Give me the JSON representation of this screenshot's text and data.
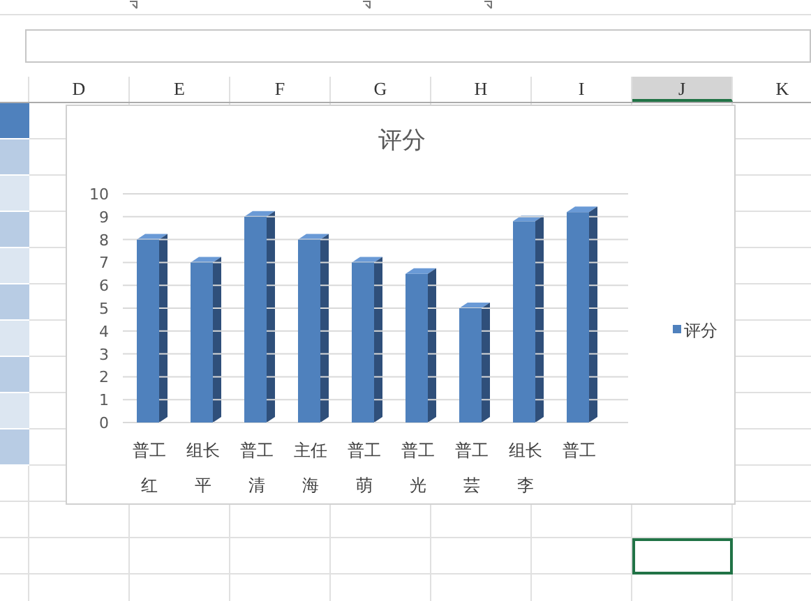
{
  "columns": [
    {
      "label": "D",
      "selected": false
    },
    {
      "label": "E",
      "selected": false
    },
    {
      "label": "F",
      "selected": false
    },
    {
      "label": "G",
      "selected": false
    },
    {
      "label": "H",
      "selected": false
    },
    {
      "label": "I",
      "selected": false
    },
    {
      "label": "J",
      "selected": true
    },
    {
      "label": "K",
      "selected": false
    }
  ],
  "shaded_cells": [
    {
      "color": "#4f81bd"
    },
    {
      "color": "#b8cce4"
    },
    {
      "color": "#dce6f1"
    },
    {
      "color": "#b8cce4"
    },
    {
      "color": "#dce6f1"
    },
    {
      "color": "#b8cce4"
    },
    {
      "color": "#dce6f1"
    },
    {
      "color": "#b8cce4"
    },
    {
      "color": "#dce6f1"
    },
    {
      "color": "#b8cce4"
    }
  ],
  "chart": {
    "chart_data": {
      "type": "bar",
      "title": "评分",
      "categories": [
        "普工红",
        "组长平",
        "普工清",
        "主任海",
        "普工萌",
        "普工光",
        "普工芸",
        "组长李",
        "普工"
      ],
      "series": [
        {
          "name": "评分",
          "color": "#4f81bd",
          "values": [
            8,
            7,
            9,
            8,
            7,
            6.5,
            5,
            8.8,
            9.2
          ]
        }
      ],
      "grid": true,
      "ylim": [
        0,
        10
      ],
      "yticks": [
        0,
        1,
        2,
        3,
        4,
        5,
        6,
        7,
        8,
        9,
        10
      ]
    }
  }
}
